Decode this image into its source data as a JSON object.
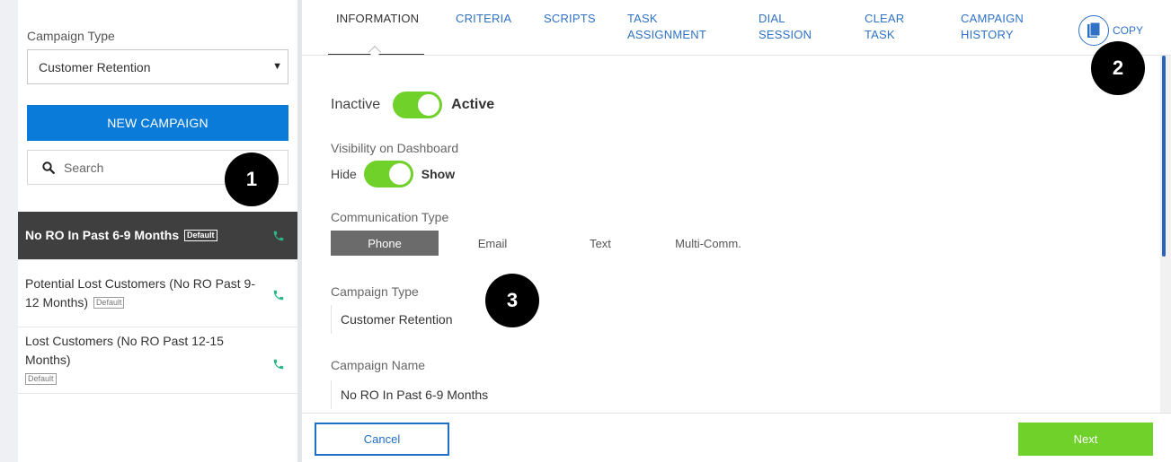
{
  "sidebar": {
    "campaign_type_label": "Campaign Type",
    "campaign_type_value": "Customer Retention",
    "new_campaign_label": "NEW CAMPAIGN",
    "search_placeholder": "Search",
    "campaigns": [
      {
        "name": "No RO In Past 6-9 Months",
        "badge": "Default",
        "active": true
      },
      {
        "name": "Potential Lost Customers (No RO Past 9-12 Months)",
        "badge": "Default",
        "active": false
      },
      {
        "name": "Lost Customers (No RO Past 12-15 Months)",
        "badge": "Default",
        "active": false
      }
    ]
  },
  "tabs": [
    {
      "line1": "INFORMATION",
      "line2": "",
      "active": true
    },
    {
      "line1": "CRITERIA",
      "line2": ""
    },
    {
      "line1": "SCRIPTS",
      "line2": ""
    },
    {
      "line1": "TASK",
      "line2": "ASSIGNMENT"
    },
    {
      "line1": "DIAL",
      "line2": "SESSION"
    },
    {
      "line1": "CLEAR",
      "line2": "TASK"
    },
    {
      "line1": "CAMPAIGN",
      "line2": "HISTORY"
    }
  ],
  "copy_label": "COPY",
  "main": {
    "status": {
      "off_label": "Inactive",
      "on_label": "Active",
      "value": true
    },
    "visibility": {
      "label": "Visibility on Dashboard",
      "off_label": "Hide",
      "on_label": "Show",
      "value": true
    },
    "communication": {
      "label": "Communication Type",
      "options": [
        "Phone",
        "Email",
        "Text",
        "Multi-Comm."
      ],
      "selected": "Phone"
    },
    "campaign_type": {
      "label": "Campaign Type",
      "value": "Customer Retention"
    },
    "campaign_name": {
      "label": "Campaign Name",
      "value": "No RO In Past 6-9 Months"
    }
  },
  "footer": {
    "cancel_label": "Cancel",
    "next_label": "Next"
  },
  "callouts": [
    "1",
    "2",
    "3"
  ],
  "colors": {
    "primary_blue": "#0a7bd9",
    "toggle_green": "#6fd12a",
    "active_item_bg": "#3f3f3f",
    "phone_icon": "#2bb58a"
  },
  "icons": {
    "search": "search-icon",
    "phone": "phone-icon",
    "copy": "copy-icon",
    "dropdown": "caret-down-icon"
  }
}
